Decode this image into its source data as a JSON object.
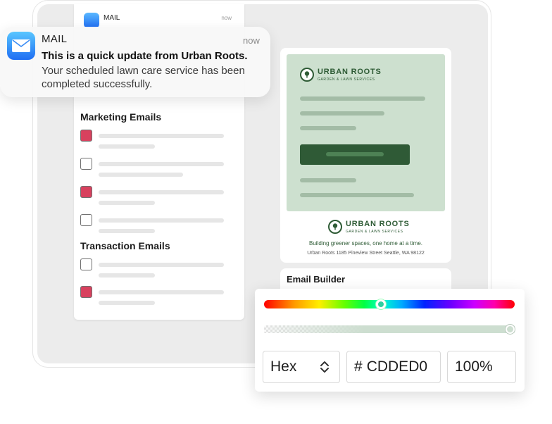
{
  "background_notification": {
    "app": "MAIL",
    "time": "now"
  },
  "notification": {
    "app": "MAIL",
    "time": "now",
    "title": "This is a quick update from Urban Roots.",
    "body": "Your scheduled lawn care service has been completed successfully.",
    "icon": "mail-icon",
    "icon_gradient": [
      "#59c6ff",
      "#1f6ef3"
    ]
  },
  "preferences": {
    "marketing_title": "Marketing Emails",
    "marketing_items": [
      {
        "checked": true
      },
      {
        "checked": false
      },
      {
        "checked": true
      },
      {
        "checked": false
      }
    ],
    "transaction_title": "Transaction Emails",
    "transaction_items": [
      {
        "checked": false
      },
      {
        "checked": true
      }
    ],
    "checked_color": "#d8415e"
  },
  "email_preview": {
    "brand_name": "URBAN ROOTS",
    "brand_sub": "GARDEN & LAWN SERVICES",
    "tagline": "Building greener spaces, one home at a time.",
    "address": "Urban Roots 1185 Pineview Street Seattle, WA 98122",
    "hero_color": "#cde0cf",
    "button_color": "#2f5a36",
    "brand_color": "#2e5b35"
  },
  "builder": {
    "title": "Email Builder"
  },
  "color_picker": {
    "format": "Hex",
    "hex_prefix": "#",
    "hex_value": "CDDED0",
    "alpha": "100%",
    "hue_value": 0.46,
    "alpha_value": 1.0
  }
}
